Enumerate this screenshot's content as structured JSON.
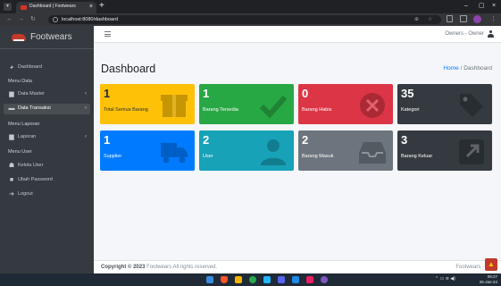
{
  "browser": {
    "tab_title": "Dashboard | Footwears",
    "tab_close": "×",
    "new_tab": "+",
    "url": "localhost:8080/dashboard",
    "minimize": "–",
    "maximize": "▢",
    "close": "×"
  },
  "brand": {
    "name": "Footwears"
  },
  "sidebar": {
    "dashboard": "Dashboard",
    "menu_data": "Menu Data",
    "data_master": "Data Master",
    "data_transaksi": "Data Transaksi",
    "menu_laporan": "Menu Laporan",
    "laporan": "Laporan",
    "menu_user": "Menu User",
    "kelola_user": "Kelola User",
    "ubah_password": "Ubah Password",
    "logout": "Logout"
  },
  "navbar": {
    "user_label": "Owners - Owner"
  },
  "page": {
    "title": "Dashboard",
    "breadcrumb_home": "Home",
    "breadcrumb_sep": "/",
    "breadcrumb_current": "Dashboard"
  },
  "boxes": [
    {
      "value": "1",
      "label": "Total Semua Barang",
      "color": "#ffc107",
      "text_color": "#1f2d3d",
      "icon": "box-icon"
    },
    {
      "value": "1",
      "label": "Barang Tersedia",
      "color": "#28a745",
      "text_color": "#ffffff",
      "icon": "check-icon"
    },
    {
      "value": "0",
      "label": "Barang Habis",
      "color": "#dc3545",
      "text_color": "#ffffff",
      "icon": "times-circle-icon"
    },
    {
      "value": "35",
      "label": "Kategori",
      "color": "#343a40",
      "text_color": "#ffffff",
      "icon": "tags-icon"
    },
    {
      "value": "1",
      "label": "Supplier",
      "color": "#007bff",
      "text_color": "#ffffff",
      "icon": "truck-icon"
    },
    {
      "value": "2",
      "label": "User",
      "color": "#17a2b8",
      "text_color": "#ffffff",
      "icon": "user-icon"
    },
    {
      "value": "2",
      "label": "Barang Masuk",
      "color": "#6c757d",
      "text_color": "#ffffff",
      "icon": "inbox-icon"
    },
    {
      "value": "3",
      "label": "Barang Keluar",
      "color": "#343a40",
      "text_color": "#ffffff",
      "icon": "external-link-icon"
    }
  ],
  "footer": {
    "copyright": "Copyright © 2023",
    "rest": " Footwears All rights reserved.",
    "right": "Footwears - 2"
  },
  "taskbar": {
    "time": "09:27",
    "date": "26-Jan-24"
  }
}
